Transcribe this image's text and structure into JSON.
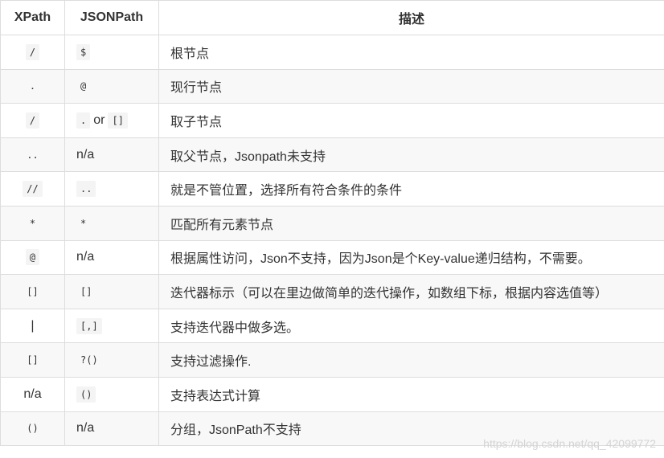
{
  "table": {
    "headers": [
      "XPath",
      "JSONPath",
      "描述"
    ],
    "rows": [
      {
        "xpath": "/",
        "jsonpath": "$",
        "desc": "根节点"
      },
      {
        "xpath": ".",
        "jsonpath": "@",
        "desc": "现行节点"
      },
      {
        "xpath": "/",
        "jsonpath_parts": [
          ".",
          "or",
          "[]"
        ],
        "desc": "取子节点"
      },
      {
        "xpath": "..",
        "jsonpath": "n/a",
        "desc": "取父节点，Jsonpath未支持"
      },
      {
        "xpath": "//",
        "jsonpath": "..",
        "desc": "就是不管位置，选择所有符合条件的条件"
      },
      {
        "xpath": "*",
        "jsonpath": "*",
        "desc": "匹配所有元素节点"
      },
      {
        "xpath": "@",
        "jsonpath": "n/a",
        "desc": "根据属性访问，Json不支持，因为Json是个Key-value递归结构，不需要。"
      },
      {
        "xpath": "[]",
        "jsonpath": "[]",
        "desc": "迭代器标示（可以在里边做简单的迭代操作，如数组下标，根据内容选值等）"
      },
      {
        "xpath": "|",
        "jsonpath": "[,]",
        "desc": "支持迭代器中做多选。"
      },
      {
        "xpath": "[]",
        "jsonpath": "?()",
        "desc": "支持过滤操作."
      },
      {
        "xpath": "n/a",
        "jsonpath": "()",
        "desc": "支持表达式计算"
      },
      {
        "xpath": "()",
        "jsonpath": "n/a",
        "desc": "分组，JsonPath不支持"
      }
    ]
  },
  "watermark": "https://blog.csdn.net/qq_42099772"
}
